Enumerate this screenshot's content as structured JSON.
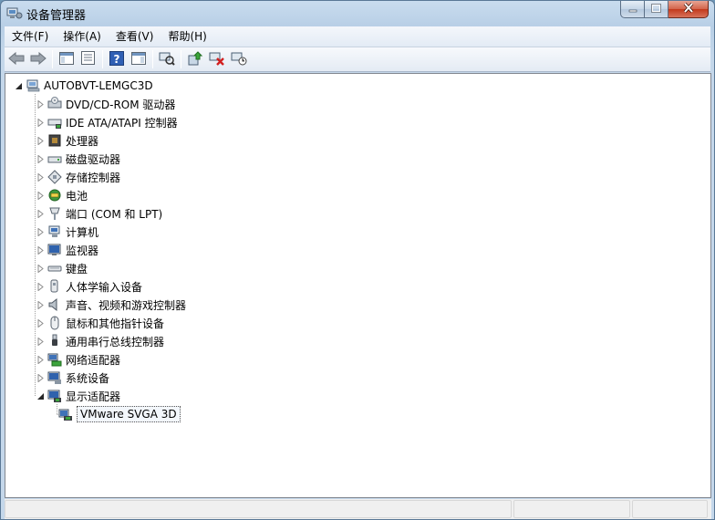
{
  "window": {
    "title": "设备管理器",
    "controls": {
      "minimize_icon": "minimize-icon",
      "maximize_icon": "maximize-icon",
      "close_icon": "close-icon"
    }
  },
  "menu": [
    {
      "label": "文件(F)"
    },
    {
      "label": "操作(A)"
    },
    {
      "label": "查看(V)"
    },
    {
      "label": "帮助(H)"
    }
  ],
  "toolbar": [
    "back-arrow-icon",
    "forward-arrow-icon",
    "show-hide-console-tree-icon",
    "properties-icon",
    "help-icon",
    "action-pane-icon",
    "scan-hardware-icon",
    "update-driver-icon",
    "uninstall-icon",
    "disable-device-icon"
  ],
  "tree": {
    "root": "AUTOBVT-LEMGC3D",
    "categories": [
      {
        "label": "DVD/CD-ROM 驱动器",
        "icon": "dvd-drive-icon"
      },
      {
        "label": "IDE ATA/ATAPI 控制器",
        "icon": "ide-controller-icon"
      },
      {
        "label": "处理器",
        "icon": "processor-icon"
      },
      {
        "label": "磁盘驱动器",
        "icon": "disk-drive-icon"
      },
      {
        "label": "存储控制器",
        "icon": "storage-controller-icon"
      },
      {
        "label": "电池",
        "icon": "battery-icon"
      },
      {
        "label": "端口 (COM 和 LPT)",
        "icon": "port-icon"
      },
      {
        "label": "计算机",
        "icon": "computer-icon"
      },
      {
        "label": "监视器",
        "icon": "monitor-icon"
      },
      {
        "label": "键盘",
        "icon": "keyboard-icon"
      },
      {
        "label": "人体学输入设备",
        "icon": "hid-icon"
      },
      {
        "label": "声音、视频和游戏控制器",
        "icon": "sound-icon"
      },
      {
        "label": "鼠标和其他指针设备",
        "icon": "mouse-icon"
      },
      {
        "label": "通用串行总线控制器",
        "icon": "usb-icon"
      },
      {
        "label": "网络适配器",
        "icon": "network-adapter-icon"
      },
      {
        "label": "系统设备",
        "icon": "system-device-icon"
      },
      {
        "label": "显示适配器",
        "icon": "display-adapter-icon",
        "expanded": true
      }
    ],
    "display_child": "VMware SVGA 3D"
  },
  "colors": {
    "accent": "#3a6ea5",
    "tree_line": "#a0a0a0"
  }
}
